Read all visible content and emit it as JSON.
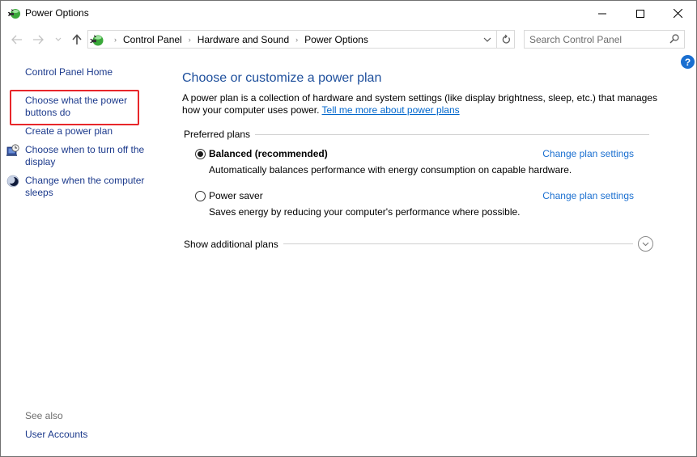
{
  "window": {
    "title": "Power Options",
    "controls": {
      "minimize": "Minimize",
      "maximize": "Maximize",
      "close": "Close"
    }
  },
  "navigation": {
    "back_icon": "arrow-left-icon",
    "forward_icon": "arrow-right-icon",
    "recent_icon": "chevron-down-icon",
    "up_icon": "arrow-up-icon",
    "breadcrumbs": [
      "Control Panel",
      "Hardware and Sound",
      "Power Options"
    ],
    "search": {
      "placeholder": "Search Control Panel",
      "value": ""
    }
  },
  "sidebar": {
    "home": "Control Panel Home",
    "items": [
      {
        "label": "Choose what the power buttons do",
        "icon": null,
        "highlighted": true
      },
      {
        "label": "Create a power plan",
        "icon": null
      },
      {
        "label": "Choose when to turn off the display",
        "icon": "monitor-clock-icon"
      },
      {
        "label": "Change when the computer sleeps",
        "icon": "moon-icon"
      }
    ],
    "see_also_label": "See also",
    "see_also_items": [
      {
        "label": "User Accounts"
      }
    ]
  },
  "main": {
    "title": "Choose or customize a power plan",
    "description": "A power plan is a collection of hardware and system settings (like display brightness, sleep, etc.) that manages how your computer uses power.",
    "learn_more_link": "Tell me more about power plans",
    "preferred_label": "Preferred plans",
    "plans": [
      {
        "name": "Balanced (recommended)",
        "selected": true,
        "description": "Automatically balances performance with energy consumption on capable hardware.",
        "action": "Change plan settings"
      },
      {
        "name": "Power saver",
        "selected": false,
        "description": "Saves energy by reducing your computer's performance where possible.",
        "action": "Change plan settings"
      }
    ],
    "additional_label": "Show additional plans"
  },
  "colors": {
    "link": "#1c3a8c",
    "heading": "#1e4f9c",
    "action_link": "#1a6fd0",
    "highlight": "#e8262a"
  }
}
